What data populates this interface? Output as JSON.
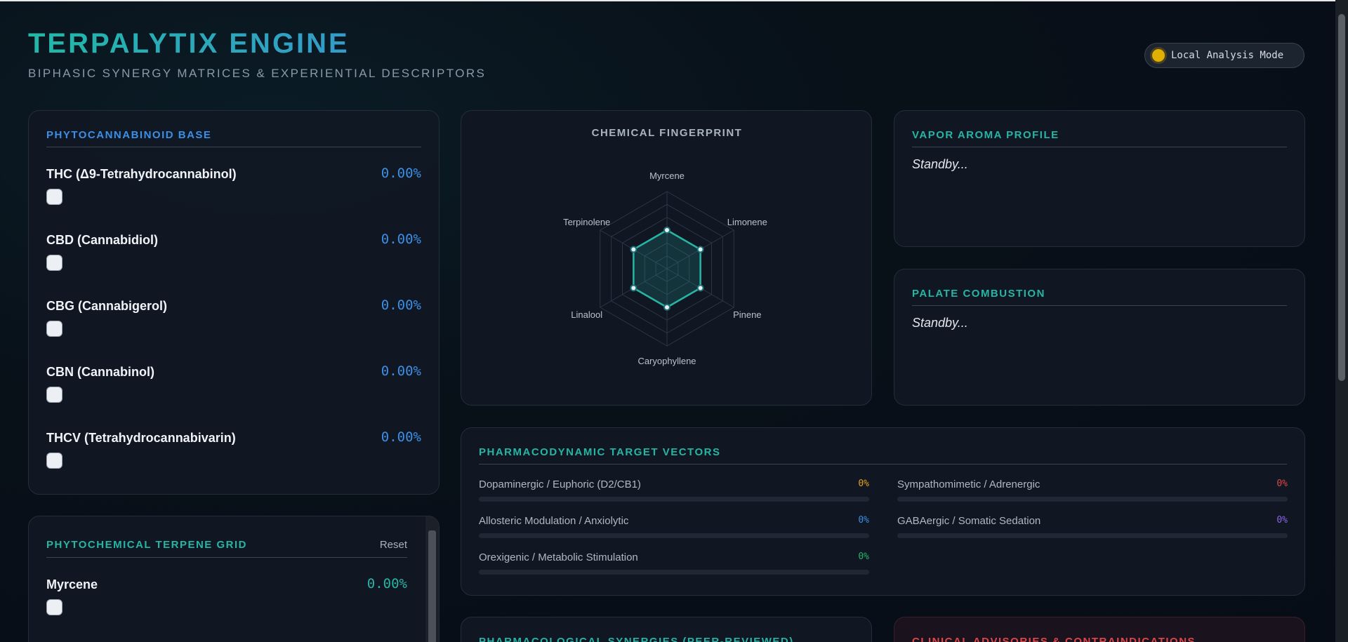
{
  "header": {
    "title": "TERPALYTIX ENGINE",
    "subtitle": "BIPHASIC SYNERGY MATRICES & EXPERIENTIAL DESCRIPTORS",
    "mode_badge": "Local Analysis Mode"
  },
  "cannabinoids": {
    "title": "PHYTOCANNABINOID BASE",
    "items": [
      {
        "label": "THC (Δ9-Tetrahydrocannabinol)",
        "value": "0.00%"
      },
      {
        "label": "CBD (Cannabidiol)",
        "value": "0.00%"
      },
      {
        "label": "CBG (Cannabigerol)",
        "value": "0.00%"
      },
      {
        "label": "CBN (Cannabinol)",
        "value": "0.00%"
      },
      {
        "label": "THCV (Tetrahydrocannabivarin)",
        "value": "0.00%"
      }
    ]
  },
  "fingerprint": {
    "title": "CHEMICAL FINGERPRINT",
    "axes": [
      "Myrcene",
      "Limonene",
      "Pinene",
      "Caryophyllene",
      "Linalool",
      "Terpinolene"
    ]
  },
  "aroma": {
    "title": "VAPOR AROMA PROFILE",
    "text": "Standby..."
  },
  "palate": {
    "title": "PALATE COMBUSTION",
    "text": "Standby..."
  },
  "vectors": {
    "title": "PHARMACODYNAMIC TARGET VECTORS",
    "items": [
      {
        "label": "Dopaminergic / Euphoric (D2/CB1)",
        "value": "0%",
        "color": "#e5a21a"
      },
      {
        "label": "Sympathomimetic / Adrenergic",
        "value": "0%",
        "color": "#e0444c"
      },
      {
        "label": "Allosteric Modulation / Anxiolytic",
        "value": "0%",
        "color": "#3b8fe6"
      },
      {
        "label": "GABAergic / Somatic Sedation",
        "value": "0%",
        "color": "#8e63e6"
      },
      {
        "label": "Orexigenic / Metabolic Stimulation",
        "value": "0%",
        "color": "#26b56a"
      }
    ]
  },
  "terpenes": {
    "title": "PHYTOCHEMICAL TERPENE GRID",
    "reset_label": "Reset",
    "items": [
      {
        "label": "Myrcene",
        "value": "0.00%"
      }
    ]
  },
  "synergies": {
    "title": "PHARMACOLOGICAL SYNERGIES (PEER-REVIEWED)"
  },
  "advisories": {
    "title": "CLINICAL ADVISORIES & CONTRAINDICATIONS"
  }
}
